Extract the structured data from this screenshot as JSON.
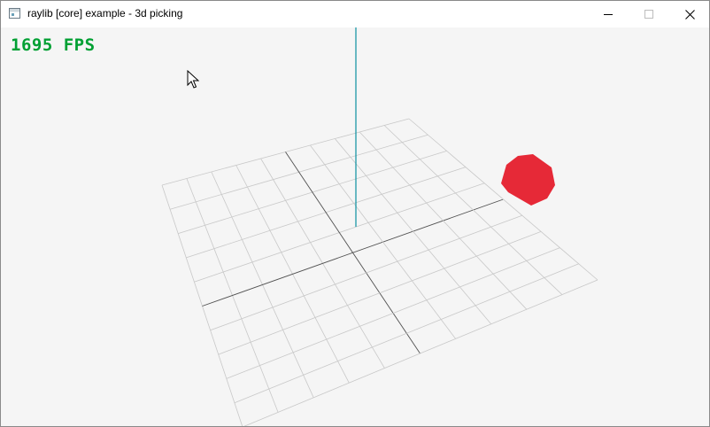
{
  "window": {
    "title": "raylib [core] example - 3d picking",
    "icon": "raylib-app-icon",
    "controls": [
      "minimize-icon",
      "maximize-icon",
      "close-icon"
    ]
  },
  "hud": {
    "fps_text": "1695 FPS",
    "fps_color": "#00a033"
  },
  "scene": {
    "background": "#f5f5f5",
    "grid_slices": 10,
    "grid_color": "#c8c8c8",
    "grid_axis_color": "#505050",
    "axis_line_color": "#0a8fa0",
    "cube_color": "#e62937"
  },
  "cursor": "arrow-pointer-icon"
}
